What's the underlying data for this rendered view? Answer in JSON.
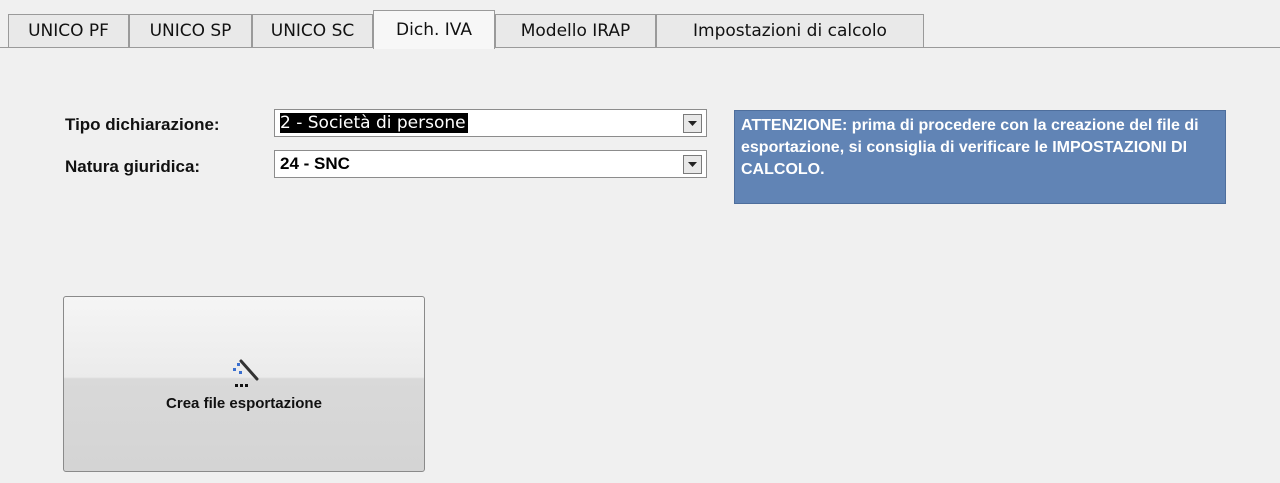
{
  "tabs": [
    {
      "label": "UNICO PF",
      "active": false
    },
    {
      "label": "UNICO SP",
      "active": false
    },
    {
      "label": "UNICO SC",
      "active": false
    },
    {
      "label": "Dich. IVA",
      "active": true
    },
    {
      "label": "Modello IRAP",
      "active": false
    },
    {
      "label": "Impostazioni di calcolo",
      "active": false
    }
  ],
  "form": {
    "tipo_label": "Tipo dichiarazione:",
    "tipo_value": "2 - Società di persone",
    "natura_label": "Natura giuridica:",
    "natura_value": "24 - SNC"
  },
  "warning": {
    "text": "ATTENZIONE: prima di procedere con la creazione del file di esportazione, si consiglia di verificare le IMPOSTAZIONI DI CALCOLO."
  },
  "create_button": {
    "label": "Crea file esportazione",
    "icon": "magic-wand-icon"
  },
  "colors": {
    "warning_bg": "#6184b5",
    "background": "#f0f0f0"
  }
}
